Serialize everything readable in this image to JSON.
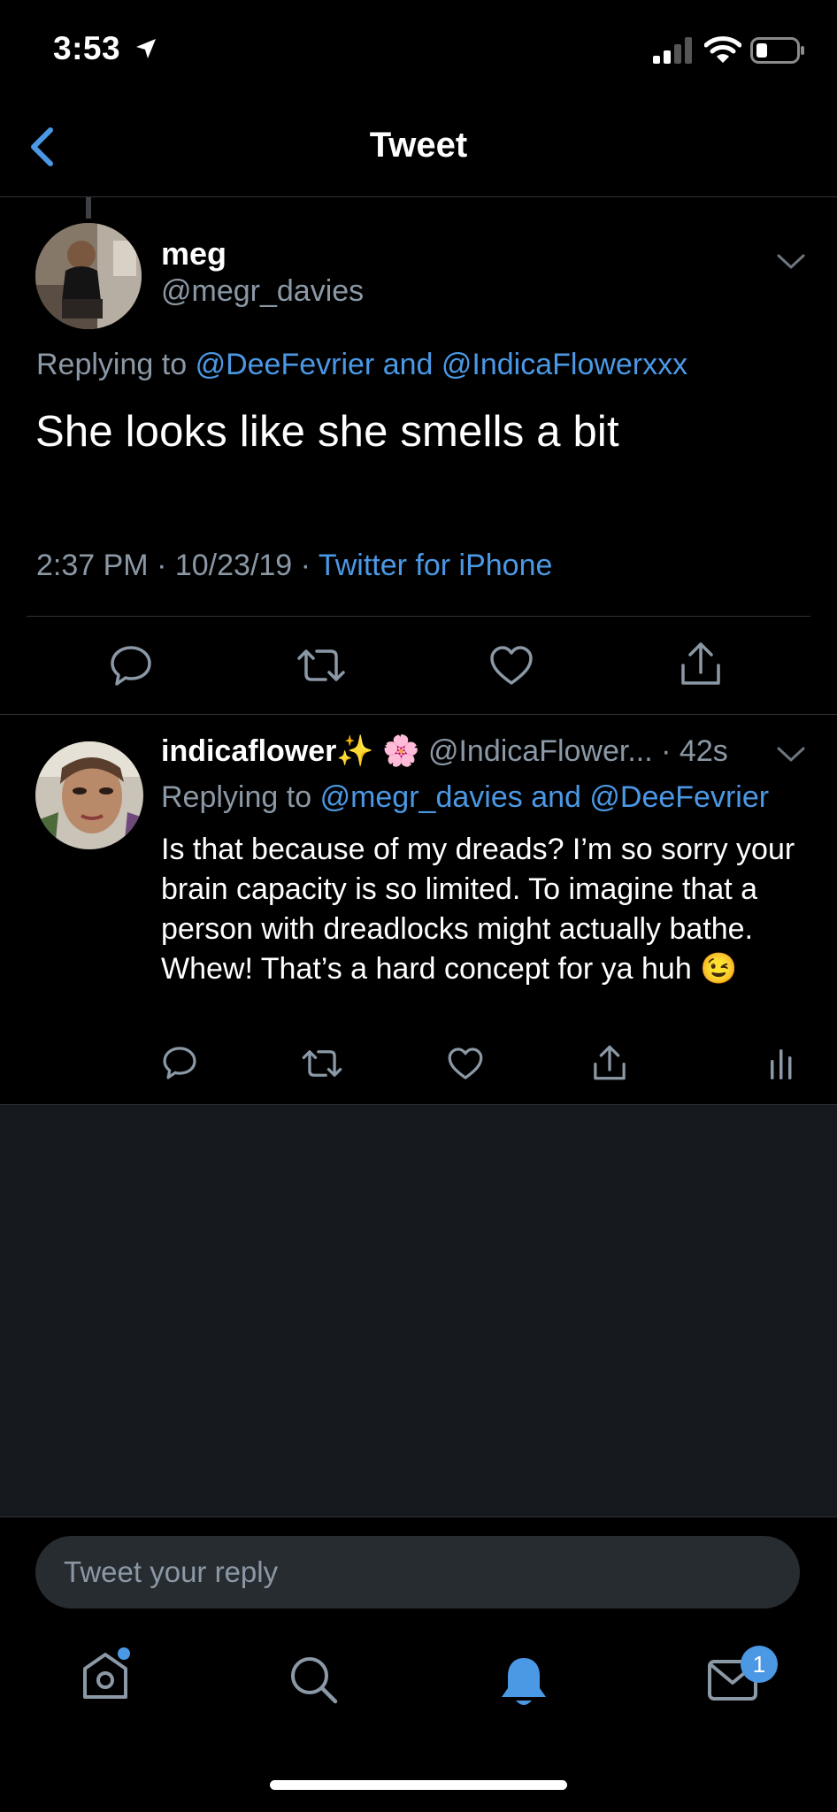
{
  "status_bar": {
    "time": "3:53"
  },
  "header": {
    "title": "Tweet"
  },
  "main_tweet": {
    "display_name": "meg",
    "handle": "@megr_davies",
    "replying_prefix": "Replying to",
    "replying_to_1": "@DeeFevrier",
    "replying_and": "and",
    "replying_to_2": "@IndicaFlowerxxx",
    "text": "She looks like she smells a bit",
    "time": "2:37 PM",
    "date": "10/23/19",
    "separator": "·",
    "source": "Twitter for iPhone"
  },
  "reply_tweet": {
    "display_name": "indicaflower",
    "name_emojis": "✨ 🌸",
    "handle": "@IndicaFlower...",
    "age": "· 42s",
    "replying_prefix": "Replying to",
    "replying_to_1": "@megr_davies",
    "replying_and": "and",
    "replying_to_2": "@DeeFevrier",
    "text": "Is that because of my dreads? I’m so sorry your brain capacity is so limited. To imagine that a person with dreadlocks might actually bathe. Whew! That’s a hard concept for ya huh",
    "emoji": "😉"
  },
  "composer": {
    "placeholder": "Tweet your reply"
  },
  "tab_bar": {
    "messages_badge": "1"
  },
  "colors": {
    "accent": "#4b98e4",
    "muted": "#8b98a5",
    "background": "#000000",
    "empty_area": "#15181c"
  },
  "icons": [
    "back-icon",
    "chevron-down-icon",
    "reply-icon",
    "retweet-icon",
    "like-icon",
    "share-icon",
    "analytics-icon",
    "home-icon",
    "search-icon",
    "notifications-icon",
    "messages-icon"
  ]
}
